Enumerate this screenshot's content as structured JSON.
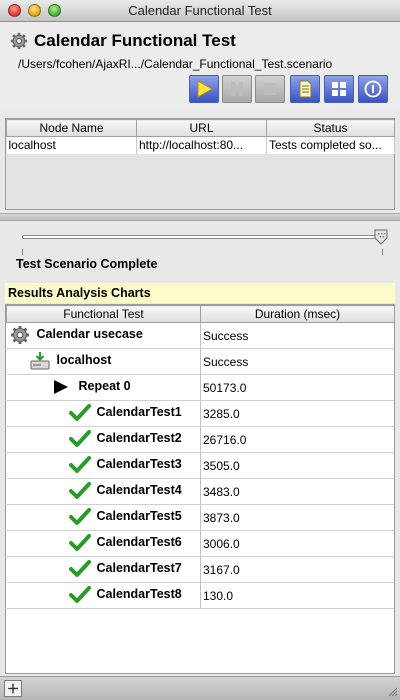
{
  "window": {
    "title": "Calendar Functional Test"
  },
  "header": {
    "title": "Calendar Functional Test",
    "path": "/Users/fcohen/AjaxRI.../Calendar_Functional_Test.scenario",
    "toolbar": {
      "play_icon": "play-icon",
      "pause_icon": "pause-icon",
      "stop_icon": "stop-icon",
      "document_icon": "document-icon",
      "grid_icon": "grid-icon",
      "info_icon": "info-icon"
    }
  },
  "nodes": {
    "columns": [
      "Node Name",
      "URL",
      "Status"
    ],
    "rows": [
      {
        "name": "localhost",
        "url": "http://localhost:80...",
        "status": "Tests completed so..."
      }
    ]
  },
  "progress": {
    "status": "Test Scenario Complete",
    "value": 1.0
  },
  "results": {
    "title": "Results Analysis Charts",
    "columns": [
      "Functional Test",
      "Duration (msec)"
    ],
    "rows": [
      {
        "label": "Calendar usecase",
        "value": "Success",
        "icon": "gear-icon"
      },
      {
        "label": "localhost",
        "value": "Success",
        "icon": "computer-icon"
      },
      {
        "label": "Repeat 0",
        "value": "50173.0",
        "icon": "triangle-icon"
      },
      {
        "label": "CalendarTest1",
        "value": "3285.0",
        "icon": "checkmark-icon"
      },
      {
        "label": "CalendarTest2",
        "value": "26716.0",
        "icon": "checkmark-icon"
      },
      {
        "label": "CalendarTest3",
        "value": "3505.0",
        "icon": "checkmark-icon"
      },
      {
        "label": "CalendarTest4",
        "value": "3483.0",
        "icon": "checkmark-icon"
      },
      {
        "label": "CalendarTest5",
        "value": "3873.0",
        "icon": "checkmark-icon"
      },
      {
        "label": "CalendarTest6",
        "value": "3006.0",
        "icon": "checkmark-icon"
      },
      {
        "label": "CalendarTest7",
        "value": "3167.0",
        "icon": "checkmark-icon"
      },
      {
        "label": "CalendarTest8",
        "value": "130.0",
        "icon": "checkmark-icon"
      }
    ]
  },
  "colors": {
    "accent": "#3a52c4",
    "success": "#2a9a2a",
    "results_header_bg": "#fbfbc8"
  }
}
